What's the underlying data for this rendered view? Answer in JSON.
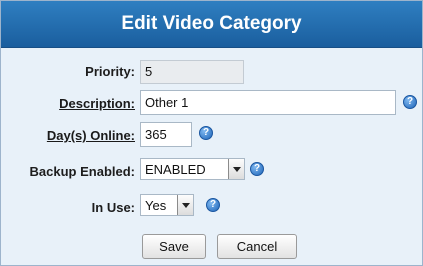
{
  "dialog": {
    "title": "Edit Video Category",
    "fields": {
      "priority": {
        "label": "Priority:",
        "value": "5"
      },
      "description": {
        "label": "Description:",
        "value": "Other 1"
      },
      "days_online": {
        "label": "Day(s) Online:",
        "value": "365"
      },
      "backup_enabled": {
        "label": "Backup Enabled:",
        "value": "ENABLED"
      },
      "in_use": {
        "label": "In Use:",
        "value": "Yes"
      }
    },
    "buttons": {
      "save": "Save",
      "cancel": "Cancel"
    },
    "help_icon_glyph": "?"
  }
}
